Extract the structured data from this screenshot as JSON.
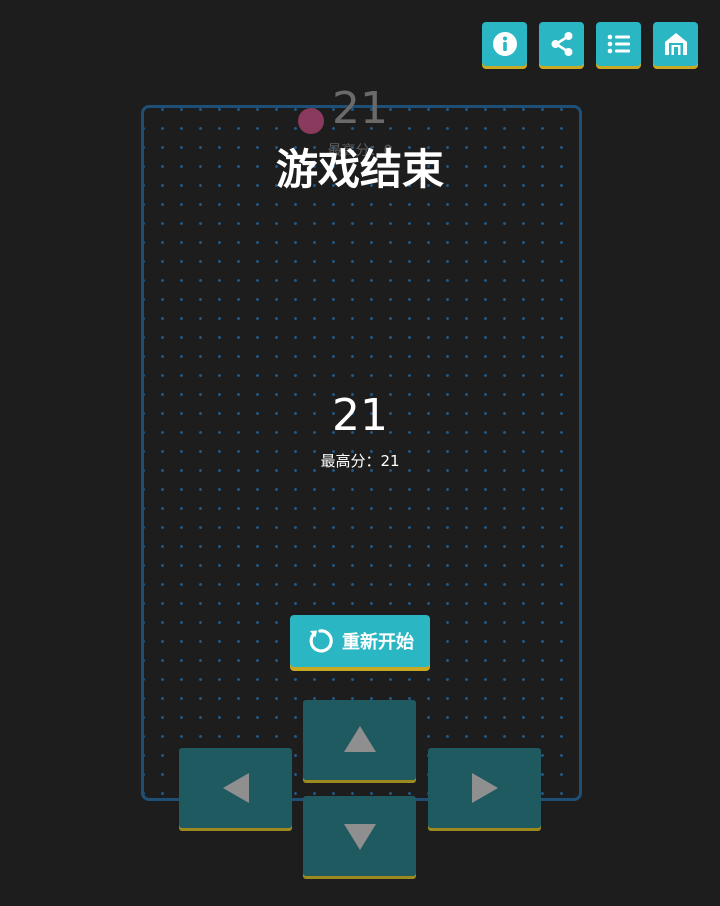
{
  "toolbar": {
    "buttons": [
      {
        "name": "info",
        "icon": "info-icon"
      },
      {
        "name": "share",
        "icon": "share-icon"
      },
      {
        "name": "list",
        "icon": "list-icon"
      },
      {
        "name": "home",
        "icon": "home-icon"
      }
    ]
  },
  "background_hud": {
    "score": "21",
    "best_label": "最高分：0"
  },
  "game_over": {
    "title": "游戏结束",
    "score": "21",
    "best_label": "最高分：21"
  },
  "restart": {
    "label": "重新开始",
    "icon": "restart-icon"
  },
  "dpad": {
    "up_icon": "arrow-up-icon",
    "down_icon": "arrow-down-icon",
    "left_icon": "arrow-left-icon",
    "right_icon": "arrow-right-icon"
  },
  "colors": {
    "background": "#1d1d1d",
    "accent": "#2bb6c4",
    "accent_shadow": "#c9a923",
    "board_border": "#1e4f77",
    "dpad": "#205a61",
    "food": "#8a3a5c"
  }
}
